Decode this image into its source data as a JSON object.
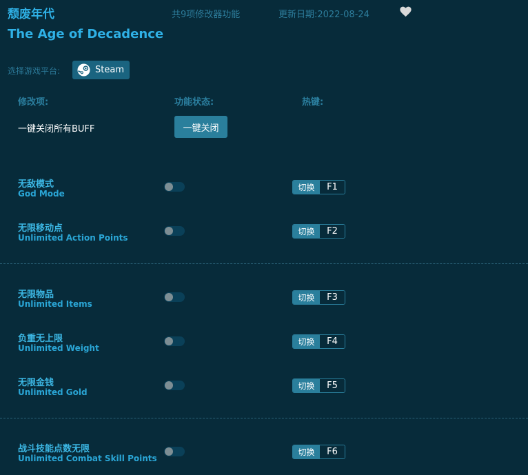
{
  "header": {
    "title_cn": "颓废年代",
    "feature_count": "共9项修改器功能",
    "update_date": "更新日期:2022-08-24",
    "title_en": "The Age of Decadence",
    "favorite_icon": "heart-icon"
  },
  "platform": {
    "label": "选择游戏平台:",
    "steam_label": "Steam",
    "steam_icon": "steam-icon"
  },
  "columns": {
    "mod": "修改项:",
    "status": "功能状态:",
    "hotkey": "热键:"
  },
  "buff": {
    "label": "一键关闭所有BUFF",
    "button": "一键关闭"
  },
  "hotkey_label": "切换",
  "colors": {
    "background": "#072b3a",
    "accent": "#2fb1e6",
    "button": "#2a7f9c",
    "toggle_track": "#0a4058"
  },
  "mods": [
    {
      "name_cn": "无敌模式",
      "name_en": "God Mode",
      "key": "F1",
      "enabled": false
    },
    {
      "name_cn": "无限移动点",
      "name_en": "Unlimited Action Points",
      "key": "F2",
      "enabled": false
    },
    {
      "name_cn": "无限物品",
      "name_en": "Unlimited Items",
      "key": "F3",
      "enabled": false
    },
    {
      "name_cn": "负重无上限",
      "name_en": "Unlimited Weight",
      "key": "F4",
      "enabled": false
    },
    {
      "name_cn": "无限金钱",
      "name_en": "Unlimited Gold",
      "key": "F5",
      "enabled": false
    },
    {
      "name_cn": "战斗技能点数无限",
      "name_en": "Unlimited Combat Skill Points",
      "key": "F6",
      "enabled": false
    }
  ]
}
